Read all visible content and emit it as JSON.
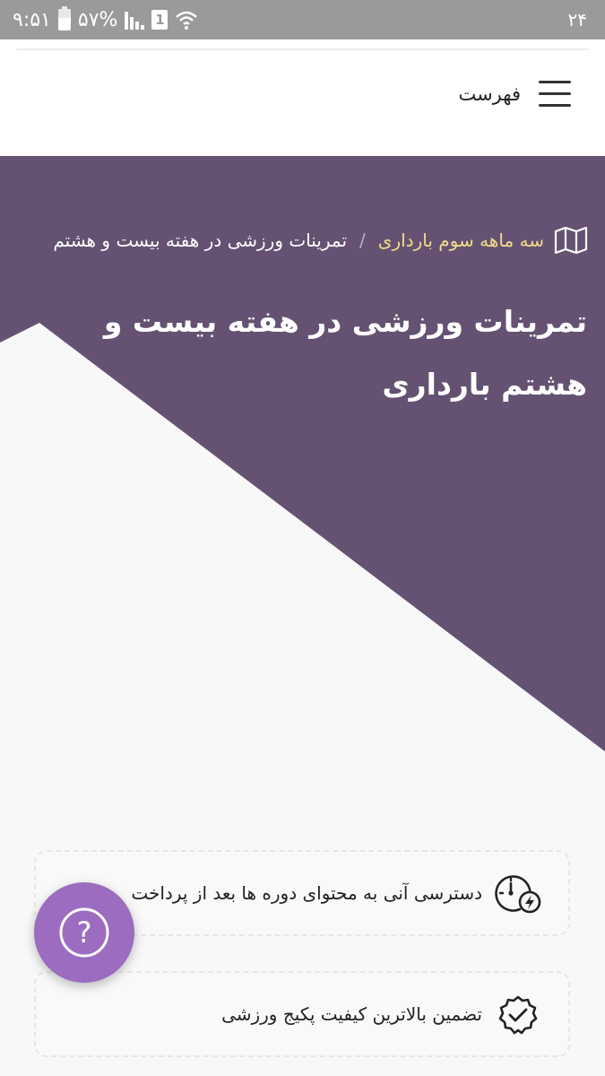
{
  "status_bar": {
    "time": "۹:۵۱",
    "battery": "۵۷%",
    "battery_level": 0.57,
    "sim": "1",
    "right_text": "۲۴"
  },
  "header": {
    "menu_label": "فهرست"
  },
  "breadcrumb": {
    "parent": "سه ماهه سوم بارداری",
    "separator": "/",
    "current": "تمرینات ورزشی در هفته بیست و هشتم"
  },
  "page": {
    "title": "تمرینات ورزشی در هفته بیست و هشتم بارداری"
  },
  "features": [
    {
      "text": "دسترسی آنی به محتوای دوره ها بعد از پرداخت",
      "icon": "speedometer-bolt-icon"
    },
    {
      "text": "تضمین بالاترین کیفیت پکیج ورزشی",
      "icon": "badge-check-icon"
    }
  ],
  "help": {
    "icon": "question-icon",
    "symbol": "?"
  },
  "colors": {
    "hero_bg": "#655272",
    "breadcrumb_link": "#f1dc8a",
    "help_button": "#9b6cbf",
    "page_bg": "#f7f8f7"
  }
}
